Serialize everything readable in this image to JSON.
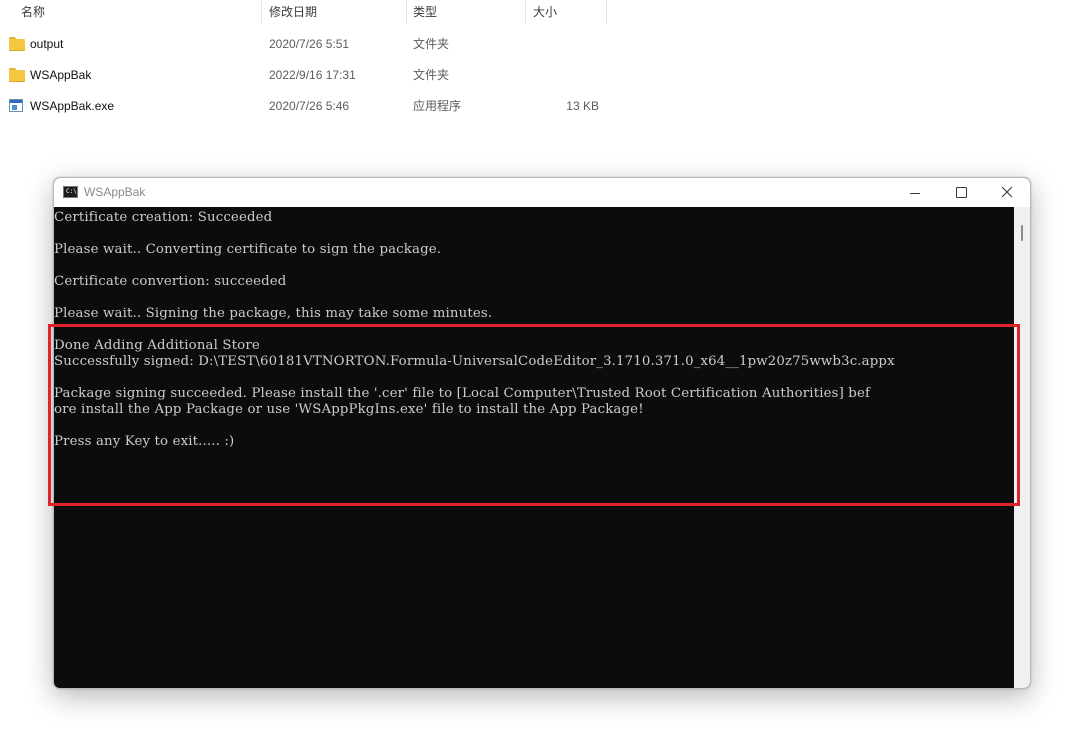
{
  "explorer": {
    "columns": {
      "name": "名称",
      "date": "修改日期",
      "type": "类型",
      "size": "大小"
    },
    "files": [
      {
        "name": "output",
        "date": "2020/7/26 5:51",
        "type": "文件夹",
        "size": "",
        "icon": "folder-icon"
      },
      {
        "name": "WSAppBak",
        "date": "2022/9/16 17:31",
        "type": "文件夹",
        "size": "",
        "icon": "folder-icon"
      },
      {
        "name": "WSAppBak.exe",
        "date": "2020/7/26 5:46",
        "type": "应用程序",
        "size": "13 KB",
        "icon": "exe-icon"
      }
    ]
  },
  "console_window": {
    "title": "WSAppBak",
    "app_icon_text": "C:\\",
    "lines": [
      "Certificate creation: Succeeded",
      "",
      "Please wait.. Converting certificate to sign the package.",
      "",
      "Certificate convertion: succeeded",
      "",
      "Please wait.. Signing the package, this may take some minutes.",
      "",
      "Done Adding Additional Store",
      "Successfully signed: D:\\TEST\\60181VTNORTON.Formula-UniversalCodeEditor_3.1710.371.0_x64__1pw20z75wwb3c.appx",
      "",
      "Package signing succeeded. Please install the '.cer' file to [Local Computer\\Trusted Root Certification Authorities] bef",
      "ore install the App Package or use 'WSAppPkgIns.exe' file to install the App Package!",
      "",
      "Press any Key to exit..... :)"
    ]
  },
  "colors": {
    "console_bg": "#0c0c0c",
    "console_text": "#cccccc",
    "highlight": "#e0222b",
    "folder": "#f5c842"
  }
}
